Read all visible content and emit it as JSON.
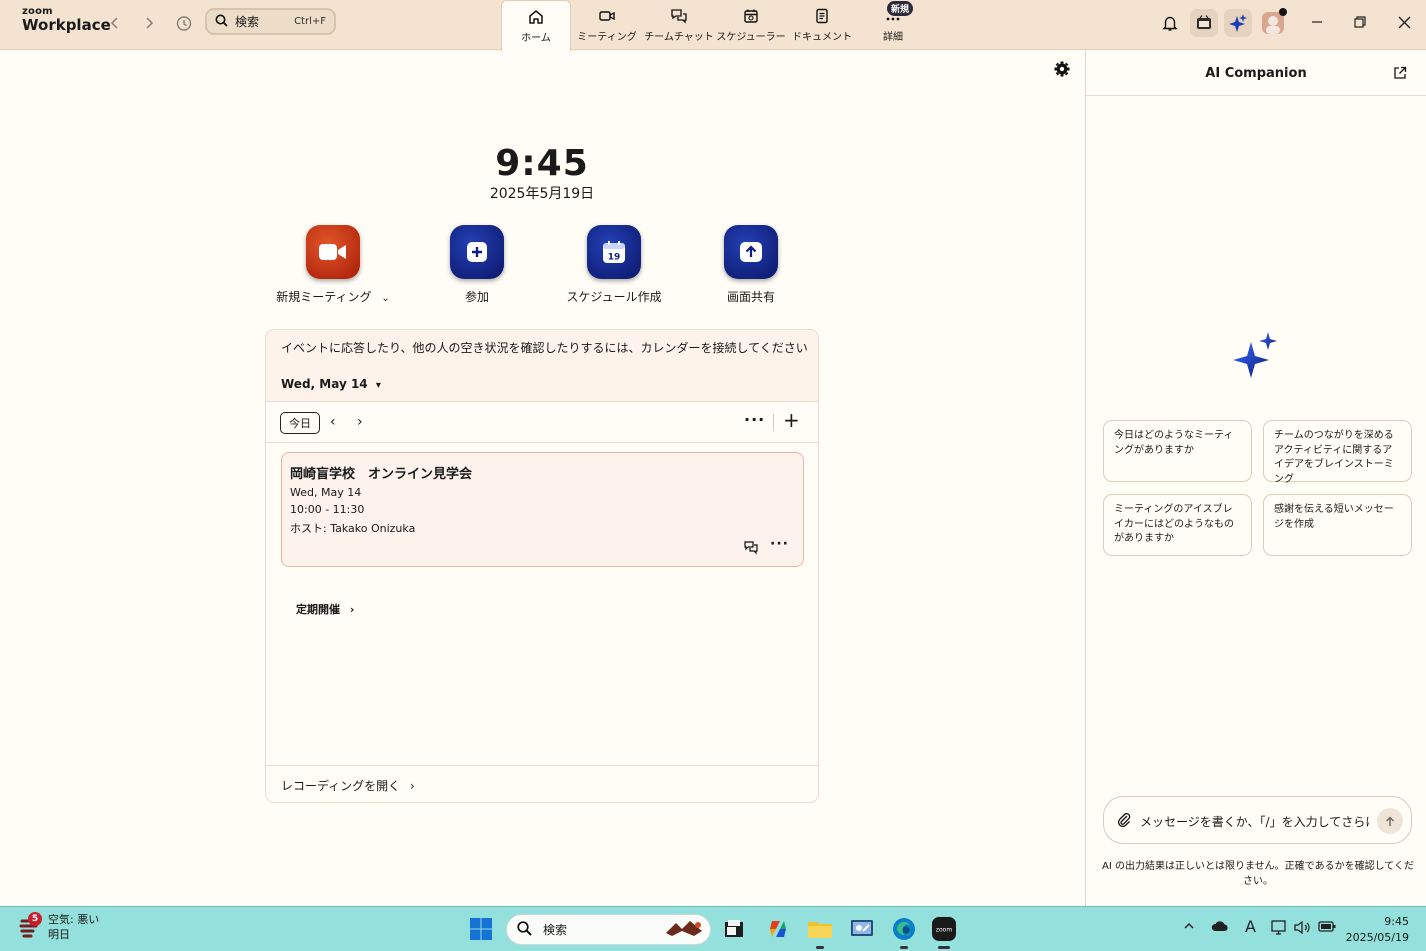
{
  "app": {
    "brand_small": "zoom",
    "brand_name": "Workplace"
  },
  "search": {
    "label": "検索",
    "shortcut": "Ctrl+F"
  },
  "nav": [
    {
      "label": "ホーム",
      "icon": "home-icon"
    },
    {
      "label": "ミーティング",
      "icon": "video-icon"
    },
    {
      "label": "チームチャット",
      "icon": "chat-icon"
    },
    {
      "label": "スケジューラー",
      "icon": "calendar-icon"
    },
    {
      "label": "ドキュメント",
      "icon": "document-icon"
    },
    {
      "label": "詳細",
      "icon": "more-icon",
      "badge": "新規"
    }
  ],
  "home": {
    "time": "9:45",
    "date": "2025年5月19日",
    "actions": [
      {
        "label": "新規ミーティング",
        "icon": "camera-icon",
        "has_dropdown": true
      },
      {
        "label": "参加",
        "icon": "plus-icon"
      },
      {
        "label": "スケジュール作成",
        "icon": "calendar-19-icon",
        "calendar_day": "19"
      },
      {
        "label": "画面共有",
        "icon": "share-up-arrow-icon"
      }
    ]
  },
  "calendar": {
    "connect_message": "イベントに応答したり、他の人の空き状況を確認したりするには、カレンダーを接続してください",
    "day_selector": "Wed, May 14",
    "today_label": "今日",
    "event": {
      "title": "岡崎盲学校　オンライン見学会",
      "date": "Wed, May 14",
      "time": "10:00 - 11:30",
      "host": "ホスト: Takako Onizuka"
    },
    "recurring_label": "定期開催",
    "open_recordings": "レコーディングを開く"
  },
  "ai": {
    "title": "AI Companion",
    "prompts": [
      "今日はどのようなミーティングがありますか",
      "チームのつながりを深めるアクティビティに関するアイデアをブレインストーミング",
      "ミーティングのアイスブレイカーにはどのようなものがありますか",
      "感謝を伝える短いメッセージを作成"
    ],
    "input_placeholder": "メッセージを書くか、「/」を入力してさらに機...",
    "disclaimer": "AI の出力結果は正しいとは限りません。正確であるかを確認してください。"
  },
  "taskbar": {
    "weather_badge": "5",
    "weather_line1": "空気: 悪い",
    "weather_line2": "明日",
    "search_label": "検索",
    "time": "9:45",
    "date": "2025/05/19",
    "ime_label": "A"
  },
  "colors": {
    "accent_red": "#c8371a",
    "accent_blue": "#0f1d80",
    "topbar_bg": "#f3e3d0",
    "taskbar_bg": "#93e0dc"
  }
}
